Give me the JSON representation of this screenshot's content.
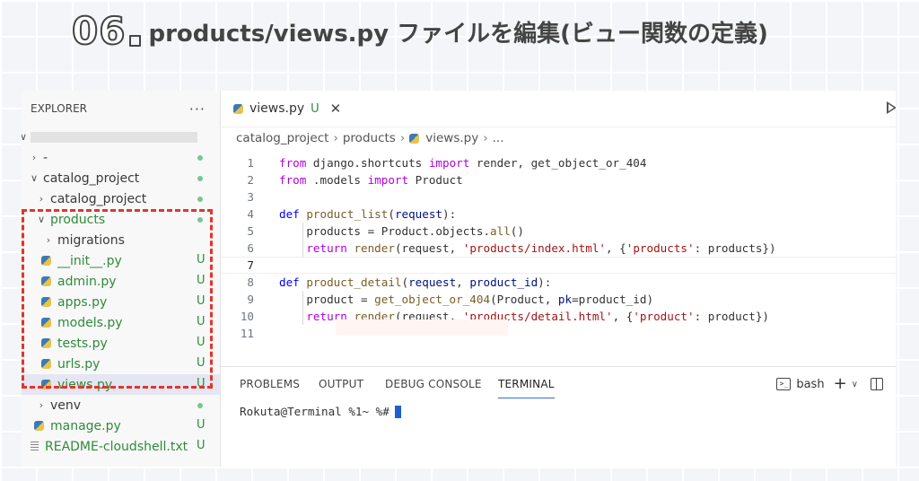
{
  "heading": {
    "number": "06",
    "text": "products/views.py ファイルを編集(ビュー関数の定義)"
  },
  "explorer": {
    "title": "EXPLORER",
    "more": "···",
    "items": [
      {
        "label": "-",
        "type": "folder"
      },
      {
        "label": "catalog_project",
        "type": "folder"
      },
      {
        "label": "catalog_project",
        "type": "folder"
      },
      {
        "label": "products",
        "type": "folder"
      },
      {
        "label": "migrations",
        "type": "folder"
      },
      {
        "label": "__init__.py",
        "status": "U"
      },
      {
        "label": "admin.py",
        "status": "U"
      },
      {
        "label": "apps.py",
        "status": "U"
      },
      {
        "label": "models.py",
        "status": "U"
      },
      {
        "label": "tests.py",
        "status": "U"
      },
      {
        "label": "urls.py",
        "status": "U"
      },
      {
        "label": "views.py",
        "status": "U"
      },
      {
        "label": "venv",
        "type": "folder"
      },
      {
        "label": "manage.py",
        "status": "U"
      },
      {
        "label": "README-cloudshell.txt",
        "status": "U"
      }
    ]
  },
  "editor": {
    "tab": {
      "label": "views.py",
      "status": "U",
      "close": "✕"
    },
    "breadcrumb": [
      "catalog_project",
      "products",
      "views.py",
      "..."
    ],
    "line_numbers": [
      "1",
      "2",
      "3",
      "4",
      "5",
      "6",
      "7",
      "8",
      "9",
      "10",
      "11"
    ],
    "code": {
      "l1": {
        "a": "from",
        "b": " django.shortcuts ",
        "c": "import",
        "d": " render, get_object_or_404"
      },
      "l2": {
        "a": "from",
        "b": " .models ",
        "c": "import",
        "d": " Product"
      },
      "l4": {
        "a": "def",
        "b": " ",
        "c": "product_list",
        "d": "(",
        "e": "request",
        "f": "):"
      },
      "l5": {
        "a": "    products = Product.objects.",
        "b": "all",
        "c": "()"
      },
      "l6": {
        "a": "    ",
        "b": "return",
        "c": " ",
        "d": "render",
        "e": "(request, ",
        "f": "'products/index.html'",
        "g": ", {",
        "h": "'products'",
        "i": ": products})"
      },
      "l8": {
        "a": "def",
        "b": " ",
        "c": "product_detail",
        "d": "(",
        "e": "request",
        "f": ", ",
        "g": "product_id",
        "h": "):"
      },
      "l9": {
        "a": "    product = ",
        "b": "get_object_or_404",
        "c": "(Product, ",
        "d": "pk",
        "e": "=product_id)"
      },
      "l10": {
        "a": "    ",
        "b": "return",
        "c": " ",
        "d": "render",
        "e": "(request, ",
        "f": "'products/detail.html'",
        "g": ", {",
        "h": "'product'",
        "i": ": product})"
      }
    }
  },
  "panel": {
    "tabs": [
      "PROBLEMS",
      "OUTPUT",
      "DEBUG CONSOLE",
      "TERMINAL"
    ],
    "active_tab": "TERMINAL",
    "shell": "bash",
    "plus": "+",
    "caret": "∨",
    "prompt": "Rokuta@Terminal %1~ %#"
  }
}
